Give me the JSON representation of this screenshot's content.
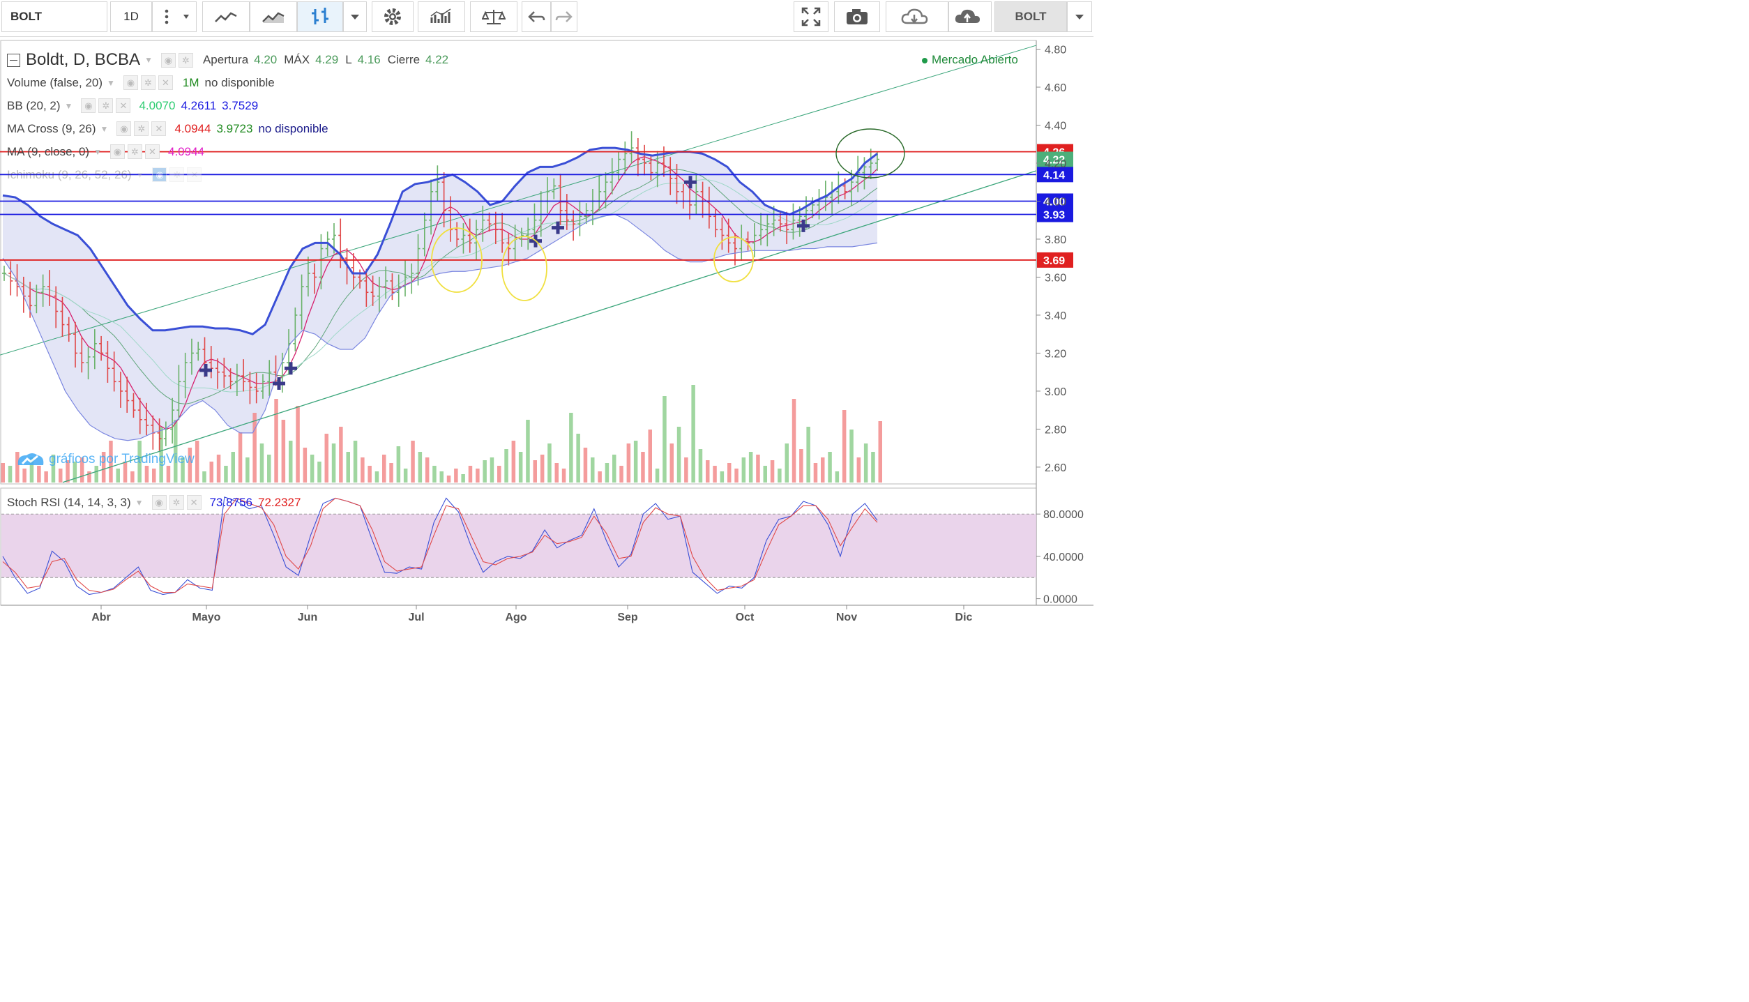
{
  "toolbar": {
    "symbol": "BOLT",
    "interval": "1D",
    "right_symbol": "BOLT"
  },
  "legend": {
    "main": {
      "name": "Boldt, D, BCBA",
      "open_label": "Apertura",
      "open": "4.20",
      "high_label": "MÁX",
      "high": "4.29",
      "low_label": "L",
      "low": "4.16",
      "close_label": "Cierre",
      "close": "4.22"
    },
    "volume": {
      "name": "Volume (false, 20)",
      "v1": "1M",
      "v2": "no disponible"
    },
    "bb": {
      "name": "BB (20, 2)",
      "v1": "4.0070",
      "v2": "4.2611",
      "v3": "3.7529"
    },
    "ma_cross": {
      "name": "MA Cross (9, 26)",
      "v1": "4.0944",
      "v2": "3.9723",
      "v3": "no disponible"
    },
    "ma": {
      "name": "MA (9, close, 0)",
      "v1": "4.0944"
    },
    "ichimoku": {
      "name": "Ichimoku (9, 26, 52, 26)"
    },
    "market_status": "Mercado Abierto",
    "watermark": "gráficos por TradingView"
  },
  "stoch": {
    "name": "Stoch RSI (14, 14, 3, 3)",
    "k": "73.8756",
    "d": "72.2327",
    "ticks": [
      "80.0000",
      "40.0000",
      "0.0000"
    ]
  },
  "colors": {
    "up": "#6ab26a",
    "down": "#e04848",
    "bb_band": "#3a4fd6",
    "ma_pink": "#d6206e",
    "stoch_k": "#3a4fd6",
    "stoch_d": "#e04848",
    "stoch_fill": "#e6cce8"
  },
  "chart_data": {
    "type": "candlestick",
    "symbol": "Boldt, D, BCBA",
    "price_ticks": [
      "4.80",
      "4.60",
      "4.40",
      "4.20",
      "4.00",
      "3.80",
      "3.60",
      "3.40",
      "3.20",
      "3.00",
      "2.80",
      "2.60"
    ],
    "ylim": [
      2.52,
      4.84
    ],
    "months": [
      "Abr",
      "Mayo",
      "Jun",
      "Jul",
      "Ago",
      "Sep",
      "Oct",
      "Nov",
      "Dic"
    ],
    "horizontal_levels": [
      {
        "value": 4.26,
        "label": "4.26",
        "color": "#e02020"
      },
      {
        "value": 4.22,
        "label": "4.22",
        "color": "#4caf7a"
      },
      {
        "value": 4.14,
        "label": "4.14",
        "color": "#1a1ae0"
      },
      {
        "value": 4.0,
        "label": "4.00",
        "color": "#1a1ae0"
      },
      {
        "value": 3.93,
        "label": "3.93",
        "color": "#1a1ae0"
      },
      {
        "value": 3.69,
        "label": "3.69",
        "color": "#e02020"
      }
    ],
    "closes": [
      3.62,
      3.58,
      3.55,
      3.5,
      3.45,
      3.52,
      3.55,
      3.5,
      3.42,
      3.35,
      3.3,
      3.2,
      3.15,
      3.18,
      3.25,
      3.2,
      3.12,
      3.05,
      3.0,
      2.95,
      2.9,
      2.85,
      2.82,
      2.78,
      2.75,
      2.8,
      2.9,
      3.05,
      3.15,
      3.2,
      3.22,
      3.15,
      3.12,
      3.1,
      3.08,
      3.05,
      3.08,
      3.05,
      3.02,
      3.0,
      3.05,
      3.1,
      3.08,
      3.15,
      3.25,
      3.4,
      3.55,
      3.62,
      3.6,
      3.75,
      3.8,
      3.82,
      3.7,
      3.65,
      3.6,
      3.58,
      3.52,
      3.5,
      3.55,
      3.58,
      3.52,
      3.55,
      3.6,
      3.62,
      3.75,
      3.9,
      4.05,
      4.1,
      3.95,
      3.85,
      3.8,
      3.82,
      3.78,
      3.85,
      3.9,
      3.88,
      3.85,
      3.78,
      3.75,
      3.8,
      3.82,
      3.85,
      3.9,
      4.0,
      4.05,
      4.08,
      3.95,
      3.9,
      3.88,
      3.92,
      3.95,
      4.0,
      4.05,
      4.1,
      4.15,
      4.22,
      4.25,
      4.28,
      4.22,
      4.2,
      4.15,
      4.2,
      4.18,
      4.12,
      4.05,
      4.0,
      3.98,
      4.05,
      4.0,
      3.92,
      3.85,
      3.82,
      3.78,
      3.75,
      3.8,
      3.78,
      3.82,
      3.85,
      3.88,
      3.9,
      3.88,
      3.85,
      3.9,
      3.92,
      3.95,
      3.98,
      4.0,
      4.02,
      4.05,
      4.08,
      4.05,
      4.1,
      4.15,
      4.18,
      4.2,
      4.22
    ],
    "bb_upper": [
      4.03,
      4.02,
      3.98,
      3.92,
      3.88,
      3.85,
      3.82,
      3.75,
      3.65,
      3.55,
      3.45,
      3.38,
      3.32,
      3.32,
      3.33,
      3.34,
      3.34,
      3.33,
      3.33,
      3.32,
      3.3,
      3.35,
      3.5,
      3.65,
      3.75,
      3.78,
      3.78,
      3.72,
      3.62,
      3.62,
      3.72,
      3.88,
      4.05,
      4.09,
      4.1,
      4.12,
      4.14,
      4.1,
      4.05,
      3.98,
      4.0,
      4.08,
      4.15,
      4.18,
      4.18,
      4.2,
      4.23,
      4.27,
      4.28,
      4.28,
      4.27,
      4.25,
      4.24,
      4.25,
      4.26,
      4.26,
      4.25,
      4.22,
      4.18,
      4.1,
      4.05,
      3.98,
      3.95,
      3.93,
      3.96,
      4.0,
      4.03,
      4.08,
      4.12,
      4.2,
      4.25
    ],
    "bb_lower": [
      3.7,
      3.6,
      3.45,
      3.3,
      3.15,
      3.0,
      2.9,
      2.82,
      2.78,
      2.75,
      2.74,
      2.75,
      2.78,
      2.8,
      2.85,
      2.92,
      2.95,
      2.9,
      2.82,
      2.78,
      2.78,
      2.9,
      3.1,
      3.25,
      3.32,
      3.3,
      3.25,
      3.22,
      3.22,
      3.28,
      3.4,
      3.5,
      3.55,
      3.58,
      3.6,
      3.62,
      3.63,
      3.63,
      3.64,
      3.65,
      3.66,
      3.68,
      3.7,
      3.74,
      3.78,
      3.82,
      3.86,
      3.9,
      3.92,
      3.93,
      3.9,
      3.85,
      3.8,
      3.74,
      3.7,
      3.68,
      3.68,
      3.7,
      3.72,
      3.73,
      3.74,
      3.74,
      3.74,
      3.74,
      3.75,
      3.75,
      3.76,
      3.76,
      3.76,
      3.77,
      3.78
    ],
    "volume": [
      14,
      12,
      22,
      10,
      18,
      12,
      8,
      20,
      10,
      16,
      15,
      18,
      8,
      12,
      22,
      30,
      10,
      15,
      8,
      30,
      12,
      10,
      40,
      12,
      45,
      18,
      25,
      30,
      8,
      15,
      20,
      12,
      22,
      36,
      18,
      50,
      28,
      20,
      60,
      45,
      30,
      55,
      25,
      20,
      15,
      35,
      28,
      40,
      22,
      30,
      18,
      12,
      8,
      20,
      14,
      26,
      10,
      30,
      22,
      18,
      12,
      8,
      5,
      10,
      6,
      12,
      10,
      16,
      18,
      12,
      24,
      30,
      22,
      45,
      16,
      20,
      28,
      14,
      10,
      50,
      35,
      25,
      18,
      8,
      14,
      20,
      12,
      28,
      30,
      22,
      38,
      10,
      62,
      28,
      40,
      18,
      70,
      24,
      16,
      12,
      8,
      14,
      10,
      18,
      22,
      20,
      12,
      16,
      10,
      28,
      60,
      24,
      40,
      14,
      18,
      22,
      8,
      52,
      38,
      18,
      28,
      22,
      44
    ],
    "stoch_k": [
      40,
      20,
      5,
      10,
      45,
      35,
      12,
      4,
      6,
      10,
      20,
      30,
      8,
      4,
      6,
      18,
      10,
      8,
      96,
      92,
      85,
      88,
      60,
      30,
      22,
      60,
      90,
      95,
      92,
      88,
      55,
      25,
      24,
      30,
      28,
      72,
      95,
      82,
      50,
      25,
      35,
      40,
      38,
      45,
      65,
      48,
      55,
      60,
      85,
      55,
      30,
      42,
      80,
      90,
      75,
      78,
      25,
      15,
      5,
      12,
      10,
      20,
      55,
      75,
      78,
      92,
      88,
      70,
      40,
      80,
      90,
      74
    ],
    "stoch_d": [
      35,
      25,
      10,
      12,
      35,
      38,
      18,
      8,
      6,
      9,
      18,
      26,
      12,
      6,
      6,
      14,
      12,
      10,
      80,
      95,
      90,
      86,
      70,
      40,
      28,
      50,
      85,
      95,
      92,
      88,
      65,
      35,
      26,
      28,
      30,
      60,
      88,
      85,
      60,
      35,
      32,
      38,
      40,
      44,
      60,
      52,
      54,
      58,
      78,
      62,
      38,
      40,
      72,
      86,
      80,
      78,
      40,
      20,
      8,
      10,
      12,
      18,
      45,
      70,
      78,
      88,
      88,
      75,
      50,
      68,
      85,
      72
    ]
  }
}
